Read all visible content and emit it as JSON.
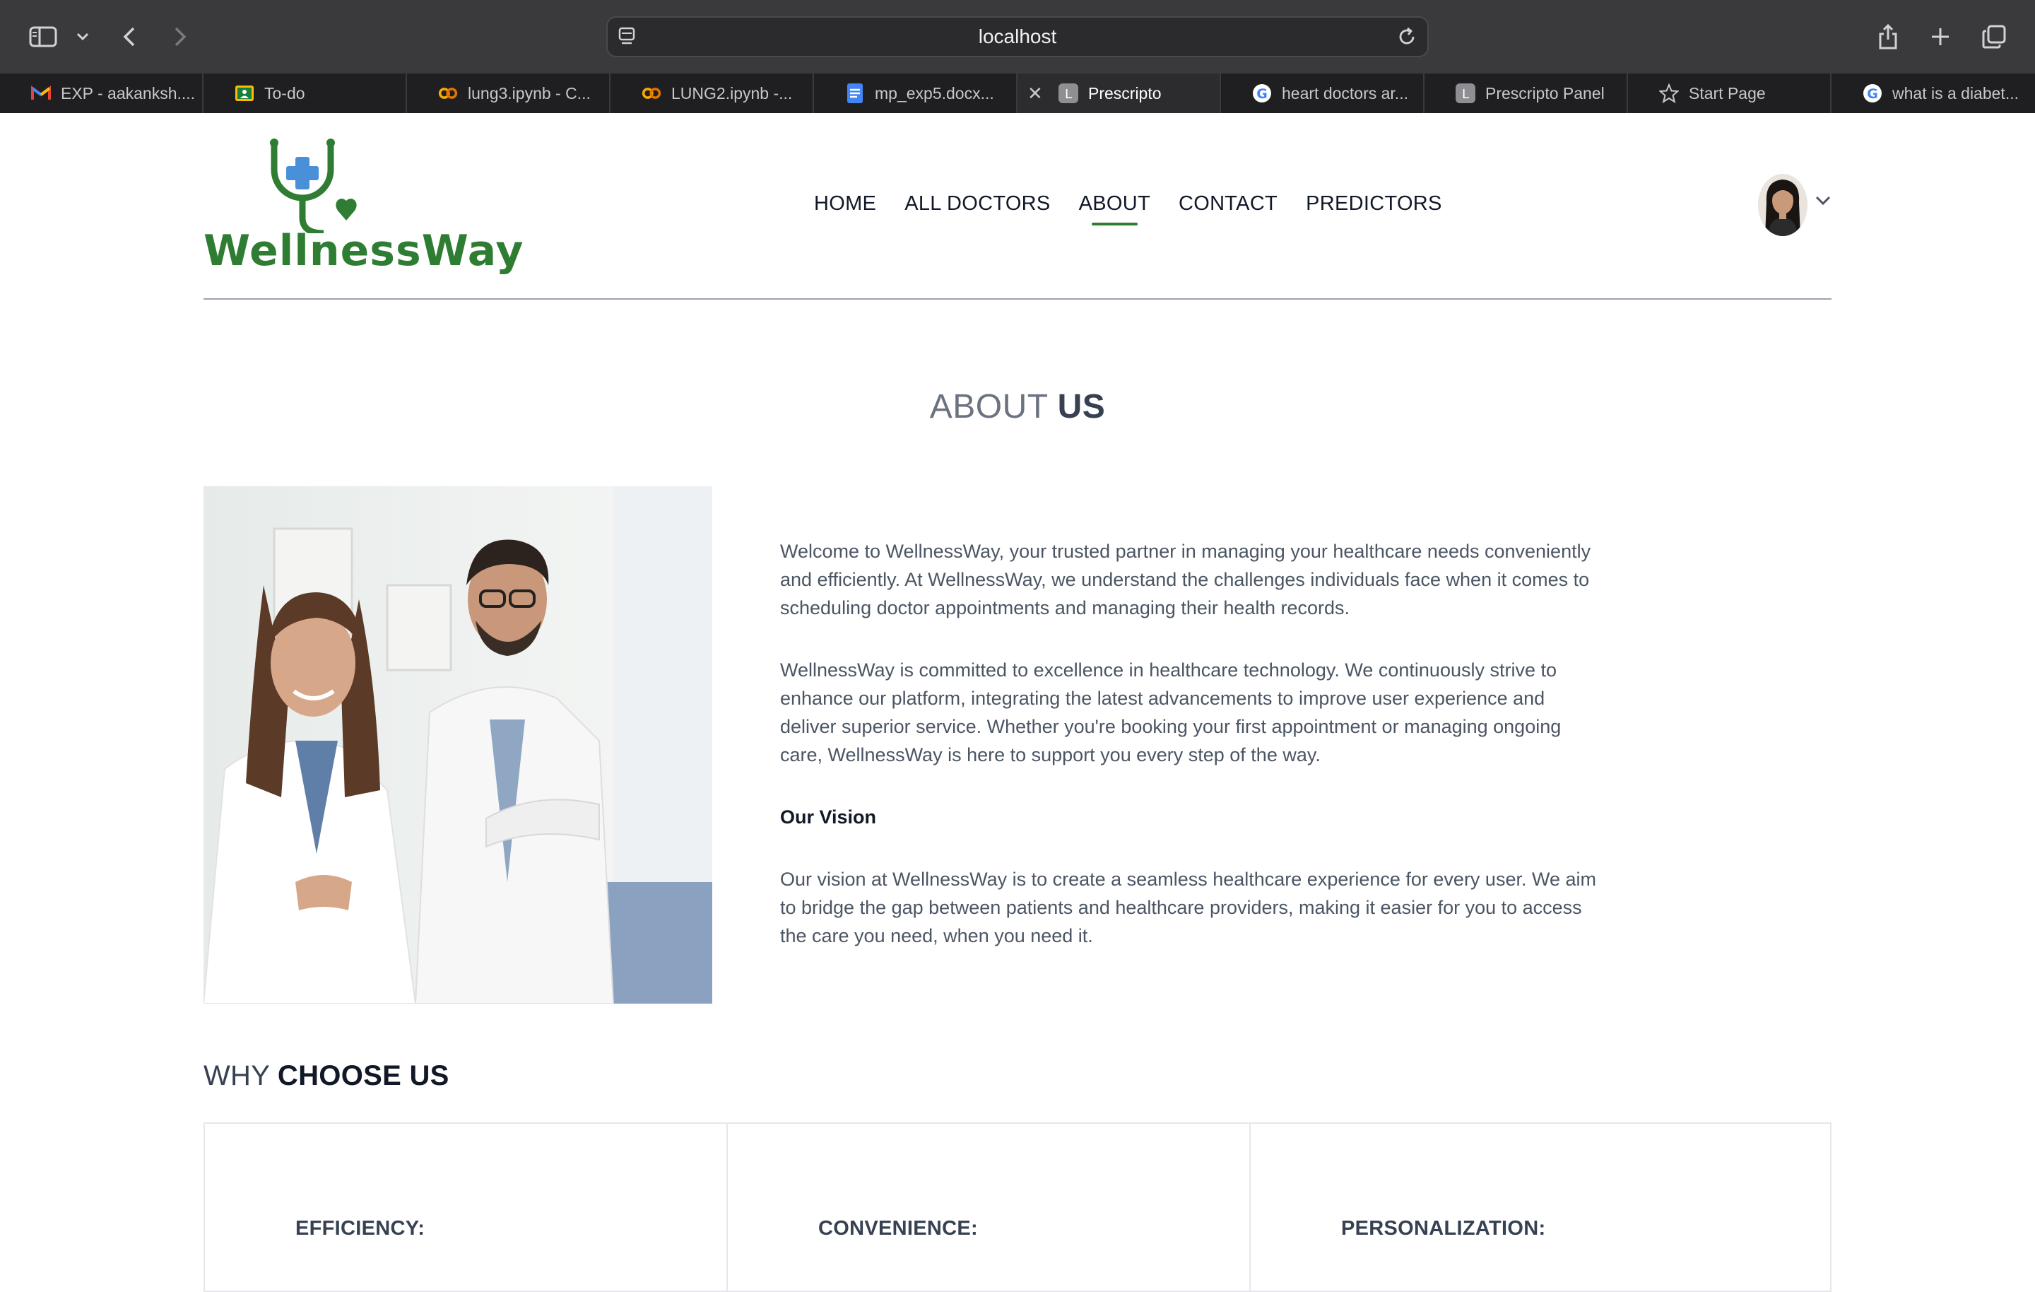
{
  "browser": {
    "address": "localhost",
    "tabs": [
      {
        "label": "EXP - aakanksh....",
        "icon": "gmail-icon"
      },
      {
        "label": "To-do",
        "icon": "classroom-icon"
      },
      {
        "label": "lung3.ipynb - C...",
        "icon": "colab-icon"
      },
      {
        "label": "LUNG2.ipynb -...",
        "icon": "colab-icon"
      },
      {
        "label": "mp_exp5.docx...",
        "icon": "docs-icon"
      },
      {
        "label": "Prescripto",
        "icon": "letter-l-icon",
        "active": true
      },
      {
        "label": "heart doctors ar...",
        "icon": "google-icon"
      },
      {
        "label": "Prescripto Panel",
        "icon": "letter-l-icon"
      },
      {
        "label": "Start Page",
        "icon": "star-icon"
      },
      {
        "label": "what is a diabet...",
        "icon": "google-icon"
      }
    ]
  },
  "header": {
    "brand": "WellnessWay",
    "nav": [
      "HOME",
      "ALL DOCTORS",
      "ABOUT",
      "CONTACT",
      "PREDICTORS"
    ],
    "active_nav": "ABOUT"
  },
  "about": {
    "title_light": "ABOUT",
    "title_bold": "US",
    "paragraphs": [
      "Welcome to WellnessWay, your trusted partner in managing your healthcare needs conveniently and efficiently. At WellnessWay, we understand the challenges individuals face when it comes to scheduling doctor appointments and managing their health records.",
      "WellnessWay is committed to excellence in healthcare technology. We continuously strive to enhance our platform, integrating the latest advancements to improve user experience and deliver superior service. Whether you're booking your first appointment or managing ongoing care, WellnessWay is here to support you every step of the way."
    ],
    "vision_heading": "Our Vision",
    "vision_text": "Our vision at WellnessWay is to create a seamless healthcare experience for every user. We aim to bridge the gap between patients and healthcare providers, making it easier for you to access the care you need, when you need it."
  },
  "why": {
    "title_light": "WHY",
    "title_bold": "CHOOSE US",
    "cards": [
      "EFFICIENCY:",
      "CONVENIENCE:",
      "PERSONALIZATION:"
    ]
  },
  "colors": {
    "brand_green": "#2e7d32",
    "cross_blue": "#4a90d9",
    "toolbar": "#3a3a3c"
  }
}
